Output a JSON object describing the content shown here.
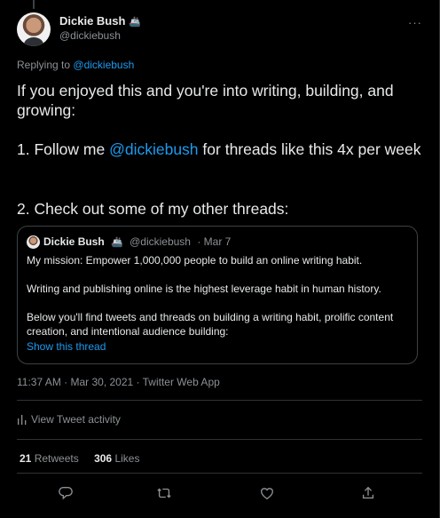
{
  "author": {
    "name": "Dickie Bush",
    "emoji": "🚢",
    "handle": "@dickiebush"
  },
  "more_label": "···",
  "replying": {
    "prefix": "Replying to",
    "handle": "@dickiebush"
  },
  "tweet": {
    "para1": "If you enjoyed this and you're into writing, building, and growing:",
    "para2_prefix": "1. Follow me",
    "para2_mention": "@dickiebush",
    "para2_suffix": "for threads like this 4x per week",
    "para3": "2. Check out some of my other threads:"
  },
  "quote": {
    "name": "Dickie Bush",
    "emoji": "🚢",
    "handle": "@dickiebush",
    "date": "· Mar 7",
    "line1": "My mission: Empower 1,000,000 people to build an online writing habit.",
    "line2": "Writing and publishing online is the highest leverage habit in human history.",
    "line3": "Below you'll find tweets and threads on building a writing habit, prolific content creation, and intentional audience building:",
    "show_thread": "Show this thread"
  },
  "timestamp": "11:37 AM · Mar 30, 2021 · Twitter Web App",
  "activity_label": "View Tweet activity",
  "stats": {
    "retweets_count": "21",
    "retweets_label": "Retweets",
    "likes_count": "306",
    "likes_label": "Likes"
  },
  "actions": [
    "reply-icon",
    "retweet-icon",
    "like-icon",
    "share-icon"
  ],
  "colors": {
    "background": "#000000",
    "accent": "#1d9bf0",
    "muted": "#8b9196",
    "border": "#2f3336"
  }
}
